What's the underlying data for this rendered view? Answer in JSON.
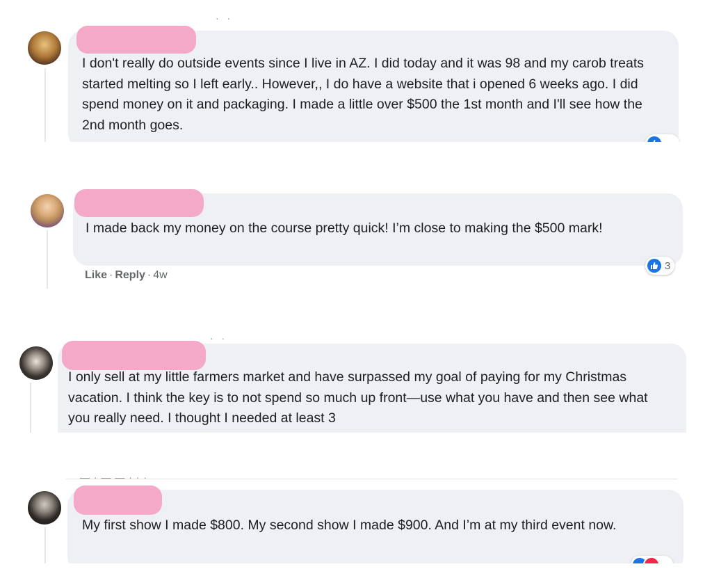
{
  "comments": [
    {
      "text": "I don't really do outside events since I live in AZ. I did today and it was 98 and my carob treats started melting so I left early.. However,, I do have a website that i opened 6 weeks ago. I did spend money on it and packaging. I made a little over $500 the 1st month and I'll see how the 2nd month goes."
    },
    {
      "text": "I made back my money on the course pretty quick! I’m close to making the $500 mark!",
      "actions": {
        "like": "Like",
        "reply": "Reply",
        "time": "4w"
      },
      "reaction_count": "3"
    },
    {
      "text": "I only sell at my little farmers market and have surpassed my goal of paying for my Christmas vacation. I think the key is to not spend so much up front—use what you have and then see what you really need. I thought I needed at least 3"
    },
    {
      "text": "My first show I made $800. My second show I made $900. And I’m at my third event now."
    }
  ],
  "colors": {
    "bubble": "#eef0f3",
    "redaction": "#f5a9c9",
    "like_blue": "#1b74e4",
    "love_red": "#f0284a",
    "meta_grey": "#65676b"
  },
  "icons": [
    "like-icon",
    "love-icon",
    "avatar"
  ]
}
